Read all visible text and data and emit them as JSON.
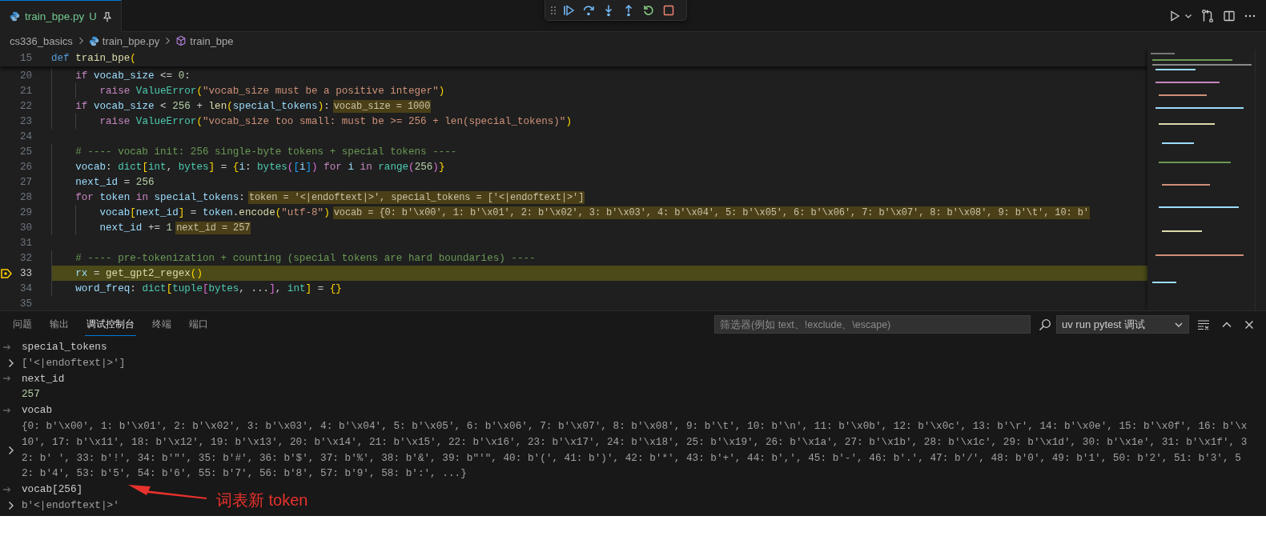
{
  "tabs": [
    {
      "label": "train_bpe.py",
      "status": "U",
      "selected": true,
      "pinned": true
    }
  ],
  "breadcrumb": [
    "cs336_basics",
    "train_bpe.py",
    "train_bpe"
  ],
  "editor": {
    "sticky_line": {
      "number": "15",
      "tokens": [
        {
          "text": "def ",
          "kind": "kw"
        },
        {
          "text": "train_bpe",
          "kind": "fn"
        },
        {
          "text": "(",
          "kind": "b1"
        }
      ]
    },
    "lines": [
      {
        "number": "20",
        "current": false,
        "tokens": [
          {
            "text": "    if ",
            "kind": "ctl"
          },
          {
            "text": "vocab_size",
            "kind": "var"
          },
          {
            "text": " <= ",
            "kind": "op"
          },
          {
            "text": "0",
            "kind": "num"
          },
          {
            "text": ":",
            "kind": "op"
          }
        ]
      },
      {
        "number": "21",
        "current": false,
        "tokens": [
          {
            "text": "        raise ",
            "kind": "ctl"
          },
          {
            "text": "ValueError",
            "kind": "type"
          },
          {
            "text": "(",
            "kind": "b1"
          },
          {
            "text": "\"vocab_size must be a positive integer\"",
            "kind": "str"
          },
          {
            "text": ")",
            "kind": "b1"
          }
        ]
      },
      {
        "number": "22",
        "current": false,
        "tokens": [
          {
            "text": "    if ",
            "kind": "ctl"
          },
          {
            "text": "vocab_size",
            "kind": "var"
          },
          {
            "text": " < ",
            "kind": "op"
          },
          {
            "text": "256",
            "kind": "num"
          },
          {
            "text": " + ",
            "kind": "op"
          },
          {
            "text": "len",
            "kind": "fn"
          },
          {
            "text": "(",
            "kind": "b1"
          },
          {
            "text": "special_tokens",
            "kind": "var"
          },
          {
            "text": ")",
            "kind": "b1"
          },
          {
            "text": ":",
            "kind": "op"
          }
        ],
        "inline_value": "vocab_size = 1000"
      },
      {
        "number": "23",
        "current": false,
        "tokens": [
          {
            "text": "        raise ",
            "kind": "ctl"
          },
          {
            "text": "ValueError",
            "kind": "type"
          },
          {
            "text": "(",
            "kind": "b1"
          },
          {
            "text": "\"vocab_size too small: must be >= 256 + len(special_tokens)\"",
            "kind": "str"
          },
          {
            "text": ")",
            "kind": "b1"
          }
        ]
      },
      {
        "number": "24",
        "current": false
      },
      {
        "number": "25",
        "current": false,
        "tokens": [
          {
            "text": "    # ---- vocab init: 256 single-byte tokens + special tokens ----",
            "kind": "comment"
          }
        ]
      },
      {
        "number": "26",
        "current": false,
        "tokens": [
          {
            "text": "    vocab",
            "kind": "var"
          },
          {
            "text": ": ",
            "kind": "op"
          },
          {
            "text": "dict",
            "kind": "type"
          },
          {
            "text": "[",
            "kind": "b1"
          },
          {
            "text": "int",
            "kind": "type"
          },
          {
            "text": ", ",
            "kind": "op"
          },
          {
            "text": "bytes",
            "kind": "type"
          },
          {
            "text": "]",
            "kind": "b1"
          },
          {
            "text": " = ",
            "kind": "op"
          },
          {
            "text": "{",
            "kind": "b1"
          },
          {
            "text": "i",
            "kind": "var"
          },
          {
            "text": ": ",
            "kind": "op"
          },
          {
            "text": "bytes",
            "kind": "type"
          },
          {
            "text": "(",
            "kind": "b2"
          },
          {
            "text": "[",
            "kind": "b3"
          },
          {
            "text": "i",
            "kind": "var"
          },
          {
            "text": "]",
            "kind": "b3"
          },
          {
            "text": ")",
            "kind": "b2"
          },
          {
            "text": " for ",
            "kind": "ctl"
          },
          {
            "text": "i",
            "kind": "var"
          },
          {
            "text": " in ",
            "kind": "ctl"
          },
          {
            "text": "range",
            "kind": "type"
          },
          {
            "text": "(",
            "kind": "b2"
          },
          {
            "text": "256",
            "kind": "num"
          },
          {
            "text": ")",
            "kind": "b2"
          },
          {
            "text": "}",
            "kind": "b1"
          }
        ]
      },
      {
        "number": "27",
        "current": false,
        "tokens": [
          {
            "text": "    next_id",
            "kind": "var"
          },
          {
            "text": " = ",
            "kind": "op"
          },
          {
            "text": "256",
            "kind": "num"
          }
        ]
      },
      {
        "number": "28",
        "current": false,
        "tokens": [
          {
            "text": "    for ",
            "kind": "ctl"
          },
          {
            "text": "token",
            "kind": "var"
          },
          {
            "text": " in ",
            "kind": "ctl"
          },
          {
            "text": "special_tokens",
            "kind": "var"
          },
          {
            "text": ":",
            "kind": "op"
          }
        ],
        "inline_value": "token = '<|endoftext|>', special_tokens = ['<|endoftext|>']"
      },
      {
        "number": "29",
        "current": false,
        "tokens": [
          {
            "text": "        vocab",
            "kind": "var"
          },
          {
            "text": "[",
            "kind": "b1"
          },
          {
            "text": "next_id",
            "kind": "var"
          },
          {
            "text": "]",
            "kind": "b1"
          },
          {
            "text": " = ",
            "kind": "op"
          },
          {
            "text": "token",
            "kind": "var"
          },
          {
            "text": ".",
            "kind": "op"
          },
          {
            "text": "encode",
            "kind": "fn"
          },
          {
            "text": "(",
            "kind": "b1"
          },
          {
            "text": "\"utf-8\"",
            "kind": "str"
          },
          {
            "text": ")",
            "kind": "b1"
          }
        ],
        "inline_value": "vocab = {0: b'\\x00', 1: b'\\x01', 2: b'\\x02', 3: b'\\x03', 4: b'\\x04', 5: b'\\x05', 6: b'\\x06', 7: b'\\x07', 8: b'\\x08', 9: b'\\t', 10: b'"
      },
      {
        "number": "30",
        "current": false,
        "tokens": [
          {
            "text": "        next_id",
            "kind": "var"
          },
          {
            "text": " += ",
            "kind": "op"
          },
          {
            "text": "1",
            "kind": "num"
          }
        ],
        "inline_value": "next_id = 257"
      },
      {
        "number": "31",
        "current": false
      },
      {
        "number": "32",
        "current": false,
        "tokens": [
          {
            "text": "    # ---- pre-tokenization + counting (special tokens are hard boundaries) ----",
            "kind": "comment"
          }
        ]
      },
      {
        "number": "33",
        "current": true,
        "tokens": [
          {
            "text": "    rx",
            "kind": "var"
          },
          {
            "text": " = ",
            "kind": "op"
          },
          {
            "text": "get_gpt2_regex",
            "kind": "fn"
          },
          {
            "text": "()",
            "kind": "b1"
          }
        ]
      },
      {
        "number": "34",
        "current": false,
        "tokens": [
          {
            "text": "    word_freq",
            "kind": "var"
          },
          {
            "text": ": ",
            "kind": "op"
          },
          {
            "text": "dict",
            "kind": "type"
          },
          {
            "text": "[",
            "kind": "b1"
          },
          {
            "text": "tuple",
            "kind": "type"
          },
          {
            "text": "[",
            "kind": "b2"
          },
          {
            "text": "bytes",
            "kind": "type"
          },
          {
            "text": ", ...",
            "kind": "op"
          },
          {
            "text": "]",
            "kind": "b2"
          },
          {
            "text": ", ",
            "kind": "op"
          },
          {
            "text": "int",
            "kind": "type"
          },
          {
            "text": "]",
            "kind": "b1"
          },
          {
            "text": " = ",
            "kind": "op"
          },
          {
            "text": "{}",
            "kind": "b1"
          }
        ]
      },
      {
        "number": "35",
        "current": false
      }
    ]
  },
  "panel": {
    "tabs": [
      {
        "label": "问题",
        "selected": false
      },
      {
        "label": "输出",
        "selected": false
      },
      {
        "label": "调试控制台",
        "selected": true
      },
      {
        "label": "终端",
        "selected": false
      },
      {
        "label": "端口",
        "selected": false
      }
    ],
    "filter": {
      "placeholder": "筛选器(例如 text、!exclude、\\escape)"
    },
    "session": "uv run pytest 调试",
    "console": [
      {
        "kind": "expression",
        "text": "special_tokens"
      },
      {
        "kind": "value",
        "expandable": true,
        "text": "['<|endoftext|>']"
      },
      {
        "kind": "expression",
        "text": "next_id"
      },
      {
        "kind": "number",
        "text": "257"
      },
      {
        "kind": "expression",
        "text": "vocab"
      },
      {
        "kind": "value",
        "expandable": true,
        "text": "{0: b'\\x00', 1: b'\\x01', 2: b'\\x02', 3: b'\\x03', 4: b'\\x04', 5: b'\\x05', 6: b'\\x06', 7: b'\\x07', 8: b'\\x08', 9: b'\\t', 10: b'\\n', 11: b'\\x0b', 12: b'\\x0c', 13: b'\\r', 14: b'\\x0e', 15: b'\\x0f', 16: b'\\x10', 17: b'\\x11', 18: b'\\x12', 19: b'\\x13', 20: b'\\x14', 21: b'\\x15', 22: b'\\x16', 23: b'\\x17', 24: b'\\x18', 25: b'\\x19', 26: b'\\x1a', 27: b'\\x1b', 28: b'\\x1c', 29: b'\\x1d', 30: b'\\x1e', 31: b'\\x1f', 32: b' ', 33: b'!', 34: b'\"', 35: b'#', 36: b'$', 37: b'%', 38: b'&', 39: b\"'\", 40: b'(', 41: b')', 42: b'*', 43: b'+', 44: b',', 45: b'-', 46: b'.', 47: b'/', 48: b'0', 49: b'1', 50: b'2', 51: b'3', 52: b'4', 53: b'5', 54: b'6', 55: b'7', 56: b'8', 57: b'9', 58: b':', ...}"
      },
      {
        "kind": "expression",
        "text": "vocab[256]"
      },
      {
        "kind": "value",
        "expandable": true,
        "text": "b'<|endoftext|>'"
      }
    ]
  },
  "annotation": {
    "text": "词表新 token"
  }
}
